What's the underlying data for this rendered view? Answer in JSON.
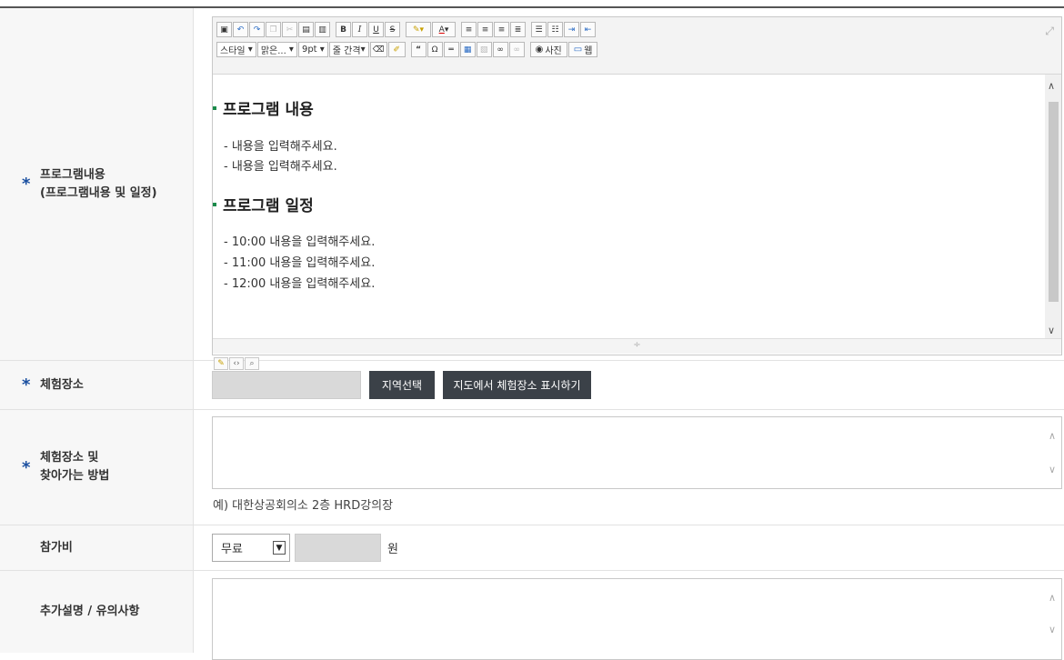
{
  "toolbar": {
    "style_label": "스타일",
    "font_label": "맑은...",
    "size_label": "9pt",
    "line_spacing_label": "줄 간격",
    "photo_label": "사진",
    "web_label": "웹"
  },
  "editor": {
    "heading1": "프로그램 내용",
    "content_lines": [
      "- 내용을 입력해주세요.",
      "- 내용을 입력해주세요."
    ],
    "heading2": "프로그램 일정",
    "schedule_lines": [
      "- 10:00 내용을 입력해주세요.",
      "- 11:00 내용을 입력해주세요.",
      "- 12:00 내용을 입력해주세요."
    ]
  },
  "rows": {
    "program": {
      "label_line1": "프로그램내용",
      "label_line2": "(프로그램내용 및 일정)"
    },
    "venue": {
      "label": "체험장소",
      "region_button": "지역선택",
      "map_button": "지도에서 체험장소 표시하기"
    },
    "directions": {
      "label_line1": "체험장소 및",
      "label_line2": "찾아가는 방법",
      "hint": "예) 대한상공회의소 2층 HRD강의장"
    },
    "fee": {
      "label": "참가비",
      "select_value": "무료",
      "unit": "원"
    },
    "notes": {
      "label": "추가설명 / 유의사항"
    }
  },
  "required_mark": "*"
}
